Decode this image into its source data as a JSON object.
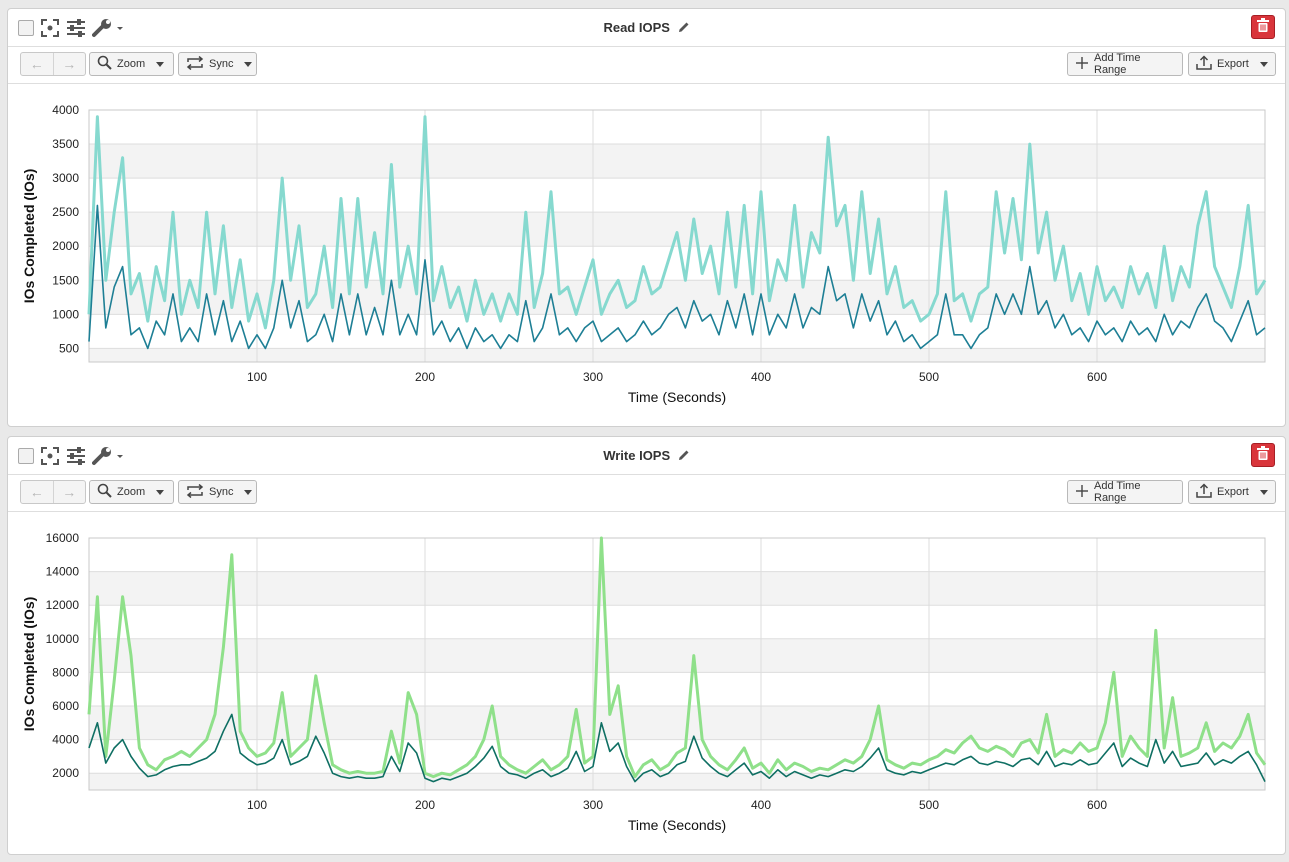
{
  "panels": [
    {
      "id": "read",
      "title": "Read IOPS",
      "toolbar": {
        "zoom_label": "Zoom",
        "sync_label": "Sync",
        "add_time_range_label": "Add Time Range",
        "export_label": "Export"
      },
      "icons": [
        "checkbox",
        "expand-icon",
        "sliders-icon",
        "wrench-icon",
        "pencil-icon",
        "trash-icon"
      ],
      "chart_data": {
        "type": "line",
        "title": "",
        "xlabel": "Time (Seconds)",
        "ylabel": "IOs Completed (IOs)",
        "xlim": [
          0,
          700
        ],
        "ylim": [
          300,
          4000
        ],
        "xticks": [
          100,
          200,
          300,
          400,
          500,
          600
        ],
        "yticks": [
          500,
          1000,
          1500,
          2000,
          2500,
          3000,
          3500,
          4000
        ],
        "grid": true,
        "legend": "none",
        "colors": {
          "light": "#86d9cf",
          "dark": "#1e7f95"
        },
        "x": [
          0,
          5,
          10,
          15,
          20,
          25,
          30,
          35,
          40,
          45,
          50,
          55,
          60,
          65,
          70,
          75,
          80,
          85,
          90,
          95,
          100,
          105,
          110,
          115,
          120,
          125,
          130,
          135,
          140,
          145,
          150,
          155,
          160,
          165,
          170,
          175,
          180,
          185,
          190,
          195,
          200,
          205,
          210,
          215,
          220,
          225,
          230,
          235,
          240,
          245,
          250,
          255,
          260,
          265,
          270,
          275,
          280,
          285,
          290,
          295,
          300,
          305,
          310,
          315,
          320,
          325,
          330,
          335,
          340,
          345,
          350,
          355,
          360,
          365,
          370,
          375,
          380,
          385,
          390,
          395,
          400,
          405,
          410,
          415,
          420,
          425,
          430,
          435,
          440,
          445,
          450,
          455,
          460,
          465,
          470,
          475,
          480,
          485,
          490,
          495,
          500,
          505,
          510,
          515,
          520,
          525,
          530,
          535,
          540,
          545,
          550,
          555,
          560,
          565,
          570,
          575,
          580,
          585,
          590,
          595,
          600,
          605,
          610,
          615,
          620,
          625,
          630,
          635,
          640,
          645,
          650,
          655,
          660,
          665,
          670,
          675,
          680,
          685,
          690,
          695,
          700
        ],
        "series": [
          {
            "values": [
              1000,
              3900,
              1500,
              2500,
              3300,
              1300,
              1600,
              900,
              1700,
              1200,
              2500,
              1000,
              1500,
              1100,
              2500,
              1300,
              2300,
              1100,
              1800,
              900,
              1300,
              800,
              1500,
              3000,
              1500,
              2300,
              1100,
              1300,
              2000,
              1100,
              2700,
              1300,
              2700,
              1400,
              2200,
              1300,
              3200,
              1400,
              2000,
              1300,
              3900,
              1200,
              1700,
              1100,
              1400,
              900,
              1500,
              1000,
              1300,
              900,
              1300,
              1000,
              2500,
              1100,
              1600,
              2800,
              1300,
              1400,
              1000,
              1400,
              1800,
              1000,
              1300,
              1500,
              1100,
              1200,
              1700,
              1300,
              1400,
              1800,
              2200,
              1500,
              2400,
              1600,
              2000,
              1300,
              2500,
              1400,
              2600,
              1300,
              2800,
              1200,
              1800,
              1500,
              2600,
              1400,
              2200,
              1900,
              3600,
              2300,
              2600,
              1500,
              2800,
              1600,
              2400,
              1300,
              1700,
              1100,
              1200,
              900,
              1000,
              1300,
              2800,
              1200,
              1300,
              900,
              1300,
              1400,
              2800,
              1900,
              2700,
              1800,
              3500,
              1900,
              2500,
              1500,
              2000,
              1200,
              1600,
              1000,
              1700,
              1200,
              1400,
              1100,
              1700,
              1300,
              1600,
              1100,
              2000,
              1200,
              1700,
              1400,
              2300,
              2800,
              1700,
              1400,
              1100,
              1700,
              2600,
              1300,
              1500
            ]
          },
          {
            "values": [
              600,
              2600,
              800,
              1400,
              1700,
              700,
              800,
              500,
              900,
              700,
              1300,
              600,
              800,
              600,
              1300,
              700,
              1200,
              600,
              900,
              500,
              700,
              500,
              800,
              1500,
              800,
              1200,
              600,
              700,
              1000,
              600,
              1300,
              700,
              1300,
              700,
              1100,
              700,
              1500,
              700,
              1000,
              700,
              1800,
              700,
              900,
              600,
              800,
              500,
              800,
              600,
              700,
              500,
              700,
              600,
              1200,
              600,
              800,
              1300,
              700,
              800,
              600,
              800,
              900,
              600,
              700,
              800,
              600,
              700,
              900,
              700,
              800,
              1000,
              1100,
              800,
              1200,
              900,
              1000,
              700,
              1200,
              800,
              1300,
              700,
              1300,
              700,
              1000,
              800,
              1300,
              800,
              1100,
              1000,
              1700,
              1200,
              1300,
              800,
              1300,
              900,
              1200,
              700,
              900,
              600,
              700,
              500,
              600,
              700,
              1300,
              700,
              700,
              500,
              700,
              800,
              1300,
              1000,
              1300,
              1000,
              1700,
              1000,
              1200,
              800,
              1000,
              700,
              800,
              600,
              900,
              700,
              800,
              600,
              900,
              700,
              800,
              600,
              1000,
              700,
              900,
              800,
              1100,
              1300,
              900,
              800,
              600,
              900,
              1200,
              700,
              800
            ]
          }
        ]
      }
    },
    {
      "id": "write",
      "title": "Write IOPS",
      "toolbar": {
        "zoom_label": "Zoom",
        "sync_label": "Sync",
        "add_time_range_label": "Add Time Range",
        "export_label": "Export"
      },
      "icons": [
        "checkbox",
        "expand-icon",
        "sliders-icon",
        "wrench-icon",
        "pencil-icon",
        "trash-icon"
      ],
      "chart_data": {
        "type": "line",
        "title": "",
        "xlabel": "Time (Seconds)",
        "ylabel": "IOs Completed (IOs)",
        "xlim": [
          0,
          700
        ],
        "ylim": [
          1000,
          16000
        ],
        "xticks": [
          100,
          200,
          300,
          400,
          500,
          600
        ],
        "yticks": [
          2000,
          4000,
          6000,
          8000,
          10000,
          12000,
          14000,
          16000
        ],
        "grid": true,
        "legend": "none",
        "colors": {
          "light": "#8fe08a",
          "dark": "#0f6f63"
        },
        "x": [
          0,
          5,
          10,
          15,
          20,
          25,
          30,
          35,
          40,
          45,
          50,
          55,
          60,
          65,
          70,
          75,
          80,
          85,
          90,
          95,
          100,
          105,
          110,
          115,
          120,
          125,
          130,
          135,
          140,
          145,
          150,
          155,
          160,
          165,
          170,
          175,
          180,
          185,
          190,
          195,
          200,
          205,
          210,
          215,
          220,
          225,
          230,
          235,
          240,
          245,
          250,
          255,
          260,
          265,
          270,
          275,
          280,
          285,
          290,
          295,
          300,
          305,
          310,
          315,
          320,
          325,
          330,
          335,
          340,
          345,
          350,
          355,
          360,
          365,
          370,
          375,
          380,
          385,
          390,
          395,
          400,
          405,
          410,
          415,
          420,
          425,
          430,
          435,
          440,
          445,
          450,
          455,
          460,
          465,
          470,
          475,
          480,
          485,
          490,
          495,
          500,
          505,
          510,
          515,
          520,
          525,
          530,
          535,
          540,
          545,
          550,
          555,
          560,
          565,
          570,
          575,
          580,
          585,
          590,
          595,
          600,
          605,
          610,
          615,
          620,
          625,
          630,
          635,
          640,
          645,
          650,
          655,
          660,
          665,
          670,
          675,
          680,
          685,
          690,
          695,
          700
        ],
        "series": [
          {
            "values": [
              5500,
              12500,
              3000,
              7500,
              12500,
              9000,
              3500,
              2500,
              2200,
              2800,
              3000,
              3300,
              3000,
              3500,
              4000,
              5500,
              9500,
              15000,
              4500,
              3500,
              3000,
              3200,
              3800,
              6800,
              3000,
              3500,
              4000,
              7800,
              5000,
              2500,
              2200,
              2000,
              2100,
              2000,
              2000,
              2100,
              4500,
              2600,
              6800,
              5500,
              2000,
              1800,
              2000,
              1900,
              2200,
              2500,
              3000,
              4000,
              6000,
              3000,
              2500,
              2200,
              2000,
              2400,
              2800,
              2200,
              2500,
              3000,
              5800,
              2600,
              3000,
              16000,
              5500,
              7200,
              3000,
              1800,
              2500,
              2800,
              2200,
              2500,
              3200,
              3500,
              9000,
              4000,
              3000,
              2500,
              2200,
              2800,
              3500,
              2300,
              2600,
              2000,
              2800,
              2200,
              2600,
              2400,
              2100,
              2300,
              2200,
              2500,
              2800,
              2600,
              3000,
              4000,
              6000,
              2800,
              2500,
              2300,
              2600,
              2500,
              2800,
              3000,
              3400,
              3200,
              3800,
              4200,
              3500,
              3300,
              3600,
              3400,
              3000,
              3800,
              4000,
              3200,
              5500,
              3000,
              3400,
              3200,
              3800,
              3300,
              3500,
              5000,
              8000,
              3000,
              4200,
              3500,
              3000,
              10500,
              3500,
              6500,
              3000,
              3200,
              3500,
              5000,
              3300,
              3800,
              3500,
              4200,
              5500,
              3200,
              2500
            ]
          },
          {
            "values": [
              3500,
              5000,
              2600,
              3500,
              4000,
              3000,
              2300,
              1800,
              1900,
              2200,
              2400,
              2500,
              2500,
              2700,
              2900,
              3300,
              4500,
              5500,
              3200,
              2800,
              2500,
              2600,
              2900,
              4000,
              2500,
              2700,
              3000,
              4200,
              3200,
              2000,
              1800,
              1700,
              1800,
              1700,
              1700,
              1800,
              3000,
              2100,
              3800,
              3200,
              1700,
              1500,
              1700,
              1600,
              1800,
              2000,
              2400,
              2900,
              3600,
              2400,
              2000,
              1900,
              1700,
              2000,
              2200,
              1800,
              2000,
              2300,
              3300,
              2100,
              2400,
              5000,
              3300,
              3800,
              2400,
              1500,
              2000,
              2200,
              1800,
              2000,
              2500,
              2700,
              4200,
              2900,
              2400,
              2000,
              1800,
              2200,
              2600,
              1900,
              2100,
              1700,
              2200,
              1800,
              2100,
              1900,
              1700,
              1900,
              1800,
              2000,
              2200,
              2100,
              2400,
              2900,
              3500,
              2200,
              2000,
              1900,
              2100,
              2000,
              2200,
              2400,
              2600,
              2500,
              2800,
              3000,
              2600,
              2500,
              2700,
              2600,
              2400,
              2800,
              2900,
              2500,
              3300,
              2400,
              2600,
              2500,
              2800,
              2500,
              2600,
              3200,
              3800,
              2400,
              2900,
              2600,
              2400,
              4000,
              2600,
              3300,
              2400,
              2500,
              2600,
              3200,
              2500,
              2800,
              2600,
              3000,
              3300,
              2500,
              1500
            ]
          }
        ]
      }
    }
  ]
}
